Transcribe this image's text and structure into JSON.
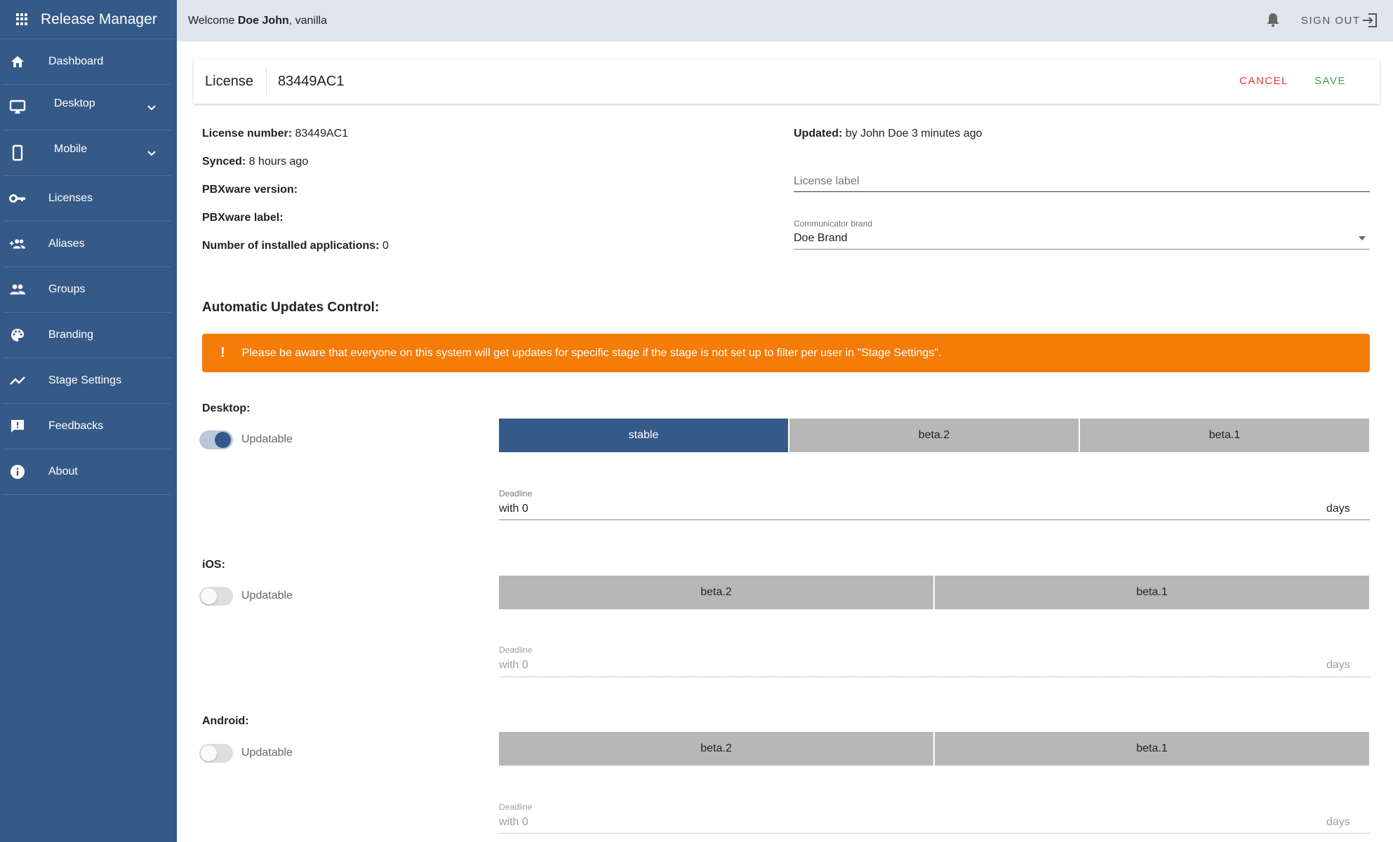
{
  "app": {
    "title": "Release Manager",
    "colors": {
      "primary": "#365a87",
      "warning": "#f57c08",
      "cancel": "#e53935",
      "save": "#43a047"
    }
  },
  "sidebar": {
    "items": [
      {
        "label": "Dashboard",
        "icon": "home-icon"
      },
      {
        "label": "Desktop",
        "icon": "desktop-icon",
        "expandable": true
      },
      {
        "label": "Mobile",
        "icon": "mobile-icon",
        "expandable": true
      },
      {
        "label": "Licenses",
        "icon": "key-icon"
      },
      {
        "label": "Aliases",
        "icon": "add-group-icon"
      },
      {
        "label": "Groups",
        "icon": "groups-icon"
      },
      {
        "label": "Branding",
        "icon": "palette-icon"
      },
      {
        "label": "Stage Settings",
        "icon": "trend-icon"
      },
      {
        "label": "Feedbacks",
        "icon": "feedback-icon"
      },
      {
        "label": "About",
        "icon": "info-icon"
      }
    ]
  },
  "header": {
    "welcome_prefix": "Welcome ",
    "user_name": "Doe John",
    "welcome_suffix": ", vanilla",
    "signout_label": "SIGN OUT"
  },
  "card": {
    "key": "License",
    "value": "83449AC1",
    "cancel_label": "CANCEL",
    "save_label": "SAVE"
  },
  "info": {
    "license_number_label": "License number:",
    "license_number": "83449AC1",
    "synced_label": "Synced:",
    "synced": "8 hours ago",
    "pbx_version_label": "PBXware version:",
    "pbx_version": "",
    "pbx_label_label": "PBXware label:",
    "pbx_label": "",
    "apps_label": "Number of installed applications:",
    "apps": "0",
    "updated_label": "Updated:",
    "updated": "by John Doe 3 minutes ago"
  },
  "form": {
    "license_label_placeholder": "License label",
    "license_label_value": "",
    "brand_label": "Communicator brand",
    "brand_value": "Doe Brand"
  },
  "updates": {
    "title": "Automatic Updates Control:",
    "alert": "Please be aware that everyone on this system will get updates for specific stage if the stage is not set up to filter per user in \"Stage Settings\".",
    "platforms": [
      {
        "name": "Desktop:",
        "toggle_label": "Updatable",
        "updatable": true,
        "stages": [
          "stable",
          "beta.2",
          "beta.1"
        ],
        "selected_stage": "stable",
        "deadline_label": "Deadline",
        "deadline_value": "with 0",
        "deadline_unit": "days"
      },
      {
        "name": "iOS:",
        "toggle_label": "Updatable",
        "updatable": false,
        "stages": [
          "beta.2",
          "beta.1"
        ],
        "selected_stage": null,
        "deadline_label": "Deadline",
        "deadline_value": "with 0",
        "deadline_unit": "days"
      },
      {
        "name": "Android:",
        "toggle_label": "Updatable",
        "updatable": false,
        "stages": [
          "beta.2",
          "beta.1"
        ],
        "selected_stage": null,
        "deadline_label": "Deadline",
        "deadline_value": "with 0",
        "deadline_unit": "days"
      }
    ]
  }
}
